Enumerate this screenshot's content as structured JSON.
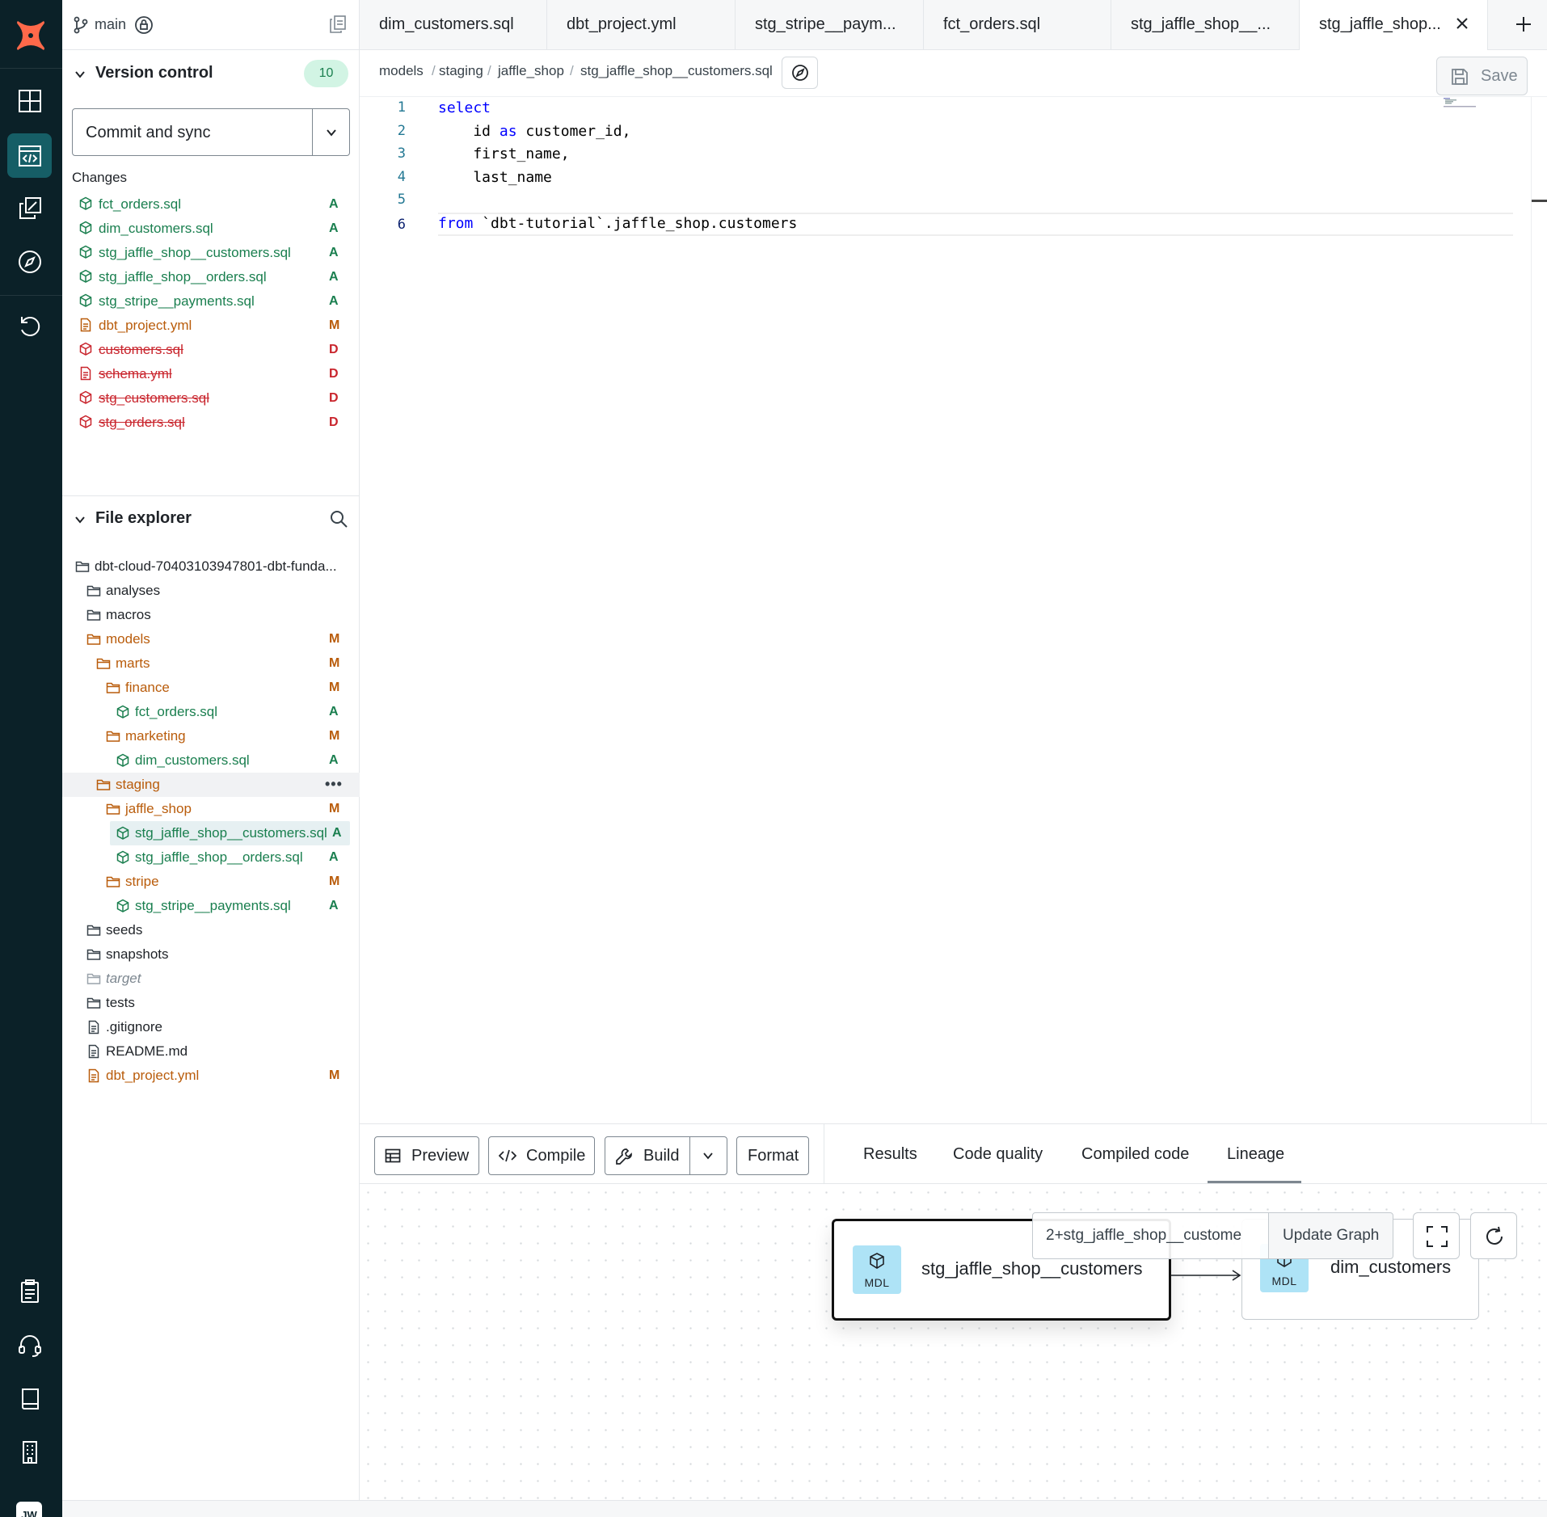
{
  "colors": {
    "rail_bg": "#0b2128",
    "rail_active": "#165e66",
    "added": "#1a7f4f",
    "modified": "#b95c0b",
    "deleted": "#c9252d",
    "brand": "#ff694a"
  },
  "rail": {
    "logo_icon": "dbt-logo-icon",
    "items": [
      {
        "icon": "grid-dashboard-icon"
      },
      {
        "icon": "code-editor-icon"
      },
      {
        "icon": "copy-stack-icon"
      },
      {
        "icon": "compass-icon"
      },
      {
        "icon": "history-icon"
      },
      {
        "icon": "clipboard-icon"
      },
      {
        "icon": "headset-icon"
      },
      {
        "icon": "book-icon"
      },
      {
        "icon": "building-icon"
      }
    ],
    "avatar_initials": "JW"
  },
  "sidebar": {
    "branch": "main",
    "version_control": {
      "title": "Version control",
      "count": "10",
      "commit_label": "Commit and sync",
      "changes_label": "Changes",
      "changes": [
        {
          "name": "fct_orders.sql",
          "status": "A",
          "kind": "model"
        },
        {
          "name": "dim_customers.sql",
          "status": "A",
          "kind": "model"
        },
        {
          "name": "stg_jaffle_shop__customers.sql",
          "status": "A",
          "kind": "model"
        },
        {
          "name": "stg_jaffle_shop__orders.sql",
          "status": "A",
          "kind": "model"
        },
        {
          "name": "stg_stripe__payments.sql",
          "status": "A",
          "kind": "model"
        },
        {
          "name": "dbt_project.yml",
          "status": "M",
          "kind": "file"
        },
        {
          "name": "customers.sql",
          "status": "D",
          "kind": "model"
        },
        {
          "name": "schema.yml",
          "status": "D",
          "kind": "file"
        },
        {
          "name": "stg_customers.sql",
          "status": "D",
          "kind": "model"
        },
        {
          "name": "stg_orders.sql",
          "status": "D",
          "kind": "model"
        }
      ]
    },
    "file_explorer": {
      "title": "File explorer",
      "tree": [
        {
          "name": "dbt-cloud-70403103947801-dbt-funda...",
          "type": "folder",
          "depth": 0,
          "badge": ""
        },
        {
          "name": "analyses",
          "type": "folder",
          "depth": 1,
          "badge": ""
        },
        {
          "name": "macros",
          "type": "folder",
          "depth": 1,
          "badge": ""
        },
        {
          "name": "models",
          "type": "folder",
          "depth": 1,
          "badge": "M"
        },
        {
          "name": "marts",
          "type": "folder",
          "depth": 2,
          "badge": "M"
        },
        {
          "name": "finance",
          "type": "folder",
          "depth": 3,
          "badge": "M"
        },
        {
          "name": "fct_orders.sql",
          "type": "model",
          "depth": 4,
          "badge": "A"
        },
        {
          "name": "marketing",
          "type": "folder",
          "depth": 3,
          "badge": "M"
        },
        {
          "name": "dim_customers.sql",
          "type": "model",
          "depth": 4,
          "badge": "A"
        },
        {
          "name": "staging",
          "type": "folder",
          "depth": 2,
          "badge": "",
          "hover": true
        },
        {
          "name": "jaffle_shop",
          "type": "folder",
          "depth": 3,
          "badge": "M"
        },
        {
          "name": "stg_jaffle_shop__customers.sql",
          "type": "model",
          "depth": 4,
          "badge": "A",
          "selected": true
        },
        {
          "name": "stg_jaffle_shop__orders.sql",
          "type": "model",
          "depth": 4,
          "badge": "A"
        },
        {
          "name": "stripe",
          "type": "folder",
          "depth": 3,
          "badge": "M"
        },
        {
          "name": "stg_stripe__payments.sql",
          "type": "model",
          "depth": 4,
          "badge": "A"
        },
        {
          "name": "seeds",
          "type": "folder",
          "depth": 1,
          "badge": ""
        },
        {
          "name": "snapshots",
          "type": "folder",
          "depth": 1,
          "badge": ""
        },
        {
          "name": "target",
          "type": "folder",
          "depth": 1,
          "badge": "",
          "ignored": true
        },
        {
          "name": "tests",
          "type": "folder",
          "depth": 1,
          "badge": ""
        },
        {
          "name": ".gitignore",
          "type": "file",
          "depth": 1,
          "badge": ""
        },
        {
          "name": "README.md",
          "type": "file",
          "depth": 1,
          "badge": ""
        },
        {
          "name": "dbt_project.yml",
          "type": "file",
          "depth": 1,
          "badge": "M"
        }
      ]
    }
  },
  "tabs": [
    {
      "label": "dim_customers.sql",
      "active": false
    },
    {
      "label": "dbt_project.yml",
      "active": false
    },
    {
      "label": "stg_stripe__paym...",
      "active": false
    },
    {
      "label": "fct_orders.sql",
      "active": false
    },
    {
      "label": "stg_jaffle_shop__...",
      "active": false
    },
    {
      "label": "stg_jaffle_shop...",
      "active": true
    }
  ],
  "breadcrumb": [
    "models",
    "staging",
    "jaffle_shop",
    "stg_jaffle_shop__customers.sql"
  ],
  "save_label": "Save",
  "editor": {
    "lines": [
      {
        "n": "1",
        "tokens": [
          {
            "t": "select",
            "kw": true
          }
        ]
      },
      {
        "n": "2",
        "tokens": [
          {
            "t": "    id "
          },
          {
            "t": "as",
            "kw": true
          },
          {
            "t": " customer_id,"
          }
        ]
      },
      {
        "n": "3",
        "tokens": [
          {
            "t": "    first_name,"
          }
        ]
      },
      {
        "n": "4",
        "tokens": [
          {
            "t": "    last_name"
          }
        ]
      },
      {
        "n": "5",
        "tokens": [
          {
            "t": ""
          }
        ]
      },
      {
        "n": "6",
        "tokens": [
          {
            "t": "from",
            "kw": true
          },
          {
            "t": " `dbt-tutorial`.jaffle_shop.customers"
          }
        ]
      }
    ]
  },
  "panel": {
    "preview": "Preview",
    "compile": "Compile",
    "build": "Build",
    "format": "Format",
    "tabs": [
      "Results",
      "Code quality",
      "Compiled code",
      "Lineage"
    ],
    "active_tab": "Lineage",
    "lineage": {
      "selector": "2+stg_jaffle_shop__custome",
      "update_label": "Update Graph",
      "nodes": [
        {
          "badge": "MDL",
          "name": "stg_jaffle_shop__customers"
        },
        {
          "badge": "MDL",
          "name": "dim_customers"
        }
      ]
    }
  }
}
